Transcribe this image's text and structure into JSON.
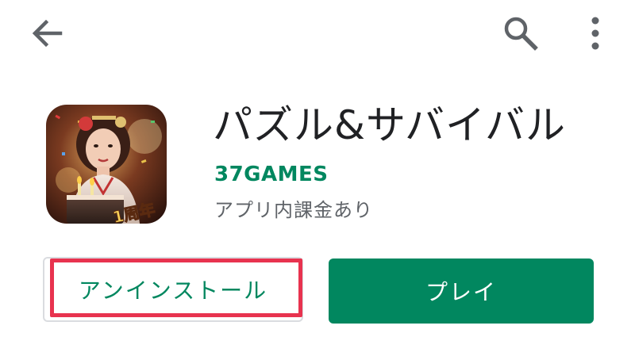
{
  "topbar": {
    "back_icon": "arrow-left-icon",
    "search_icon": "search-icon",
    "more_icon": "more-vert-icon"
  },
  "app": {
    "title": "パズル&サバイバル",
    "developer": "37GAMES",
    "iap_note": "アプリ内課金あり",
    "icon_badge": "1周年"
  },
  "actions": {
    "uninstall_label": "アンインストール",
    "play_label": "プレイ"
  },
  "colors": {
    "accent_green": "#01875f",
    "highlight_red": "#e8334f",
    "title_text": "#202124",
    "secondary_text": "#5f6368"
  }
}
